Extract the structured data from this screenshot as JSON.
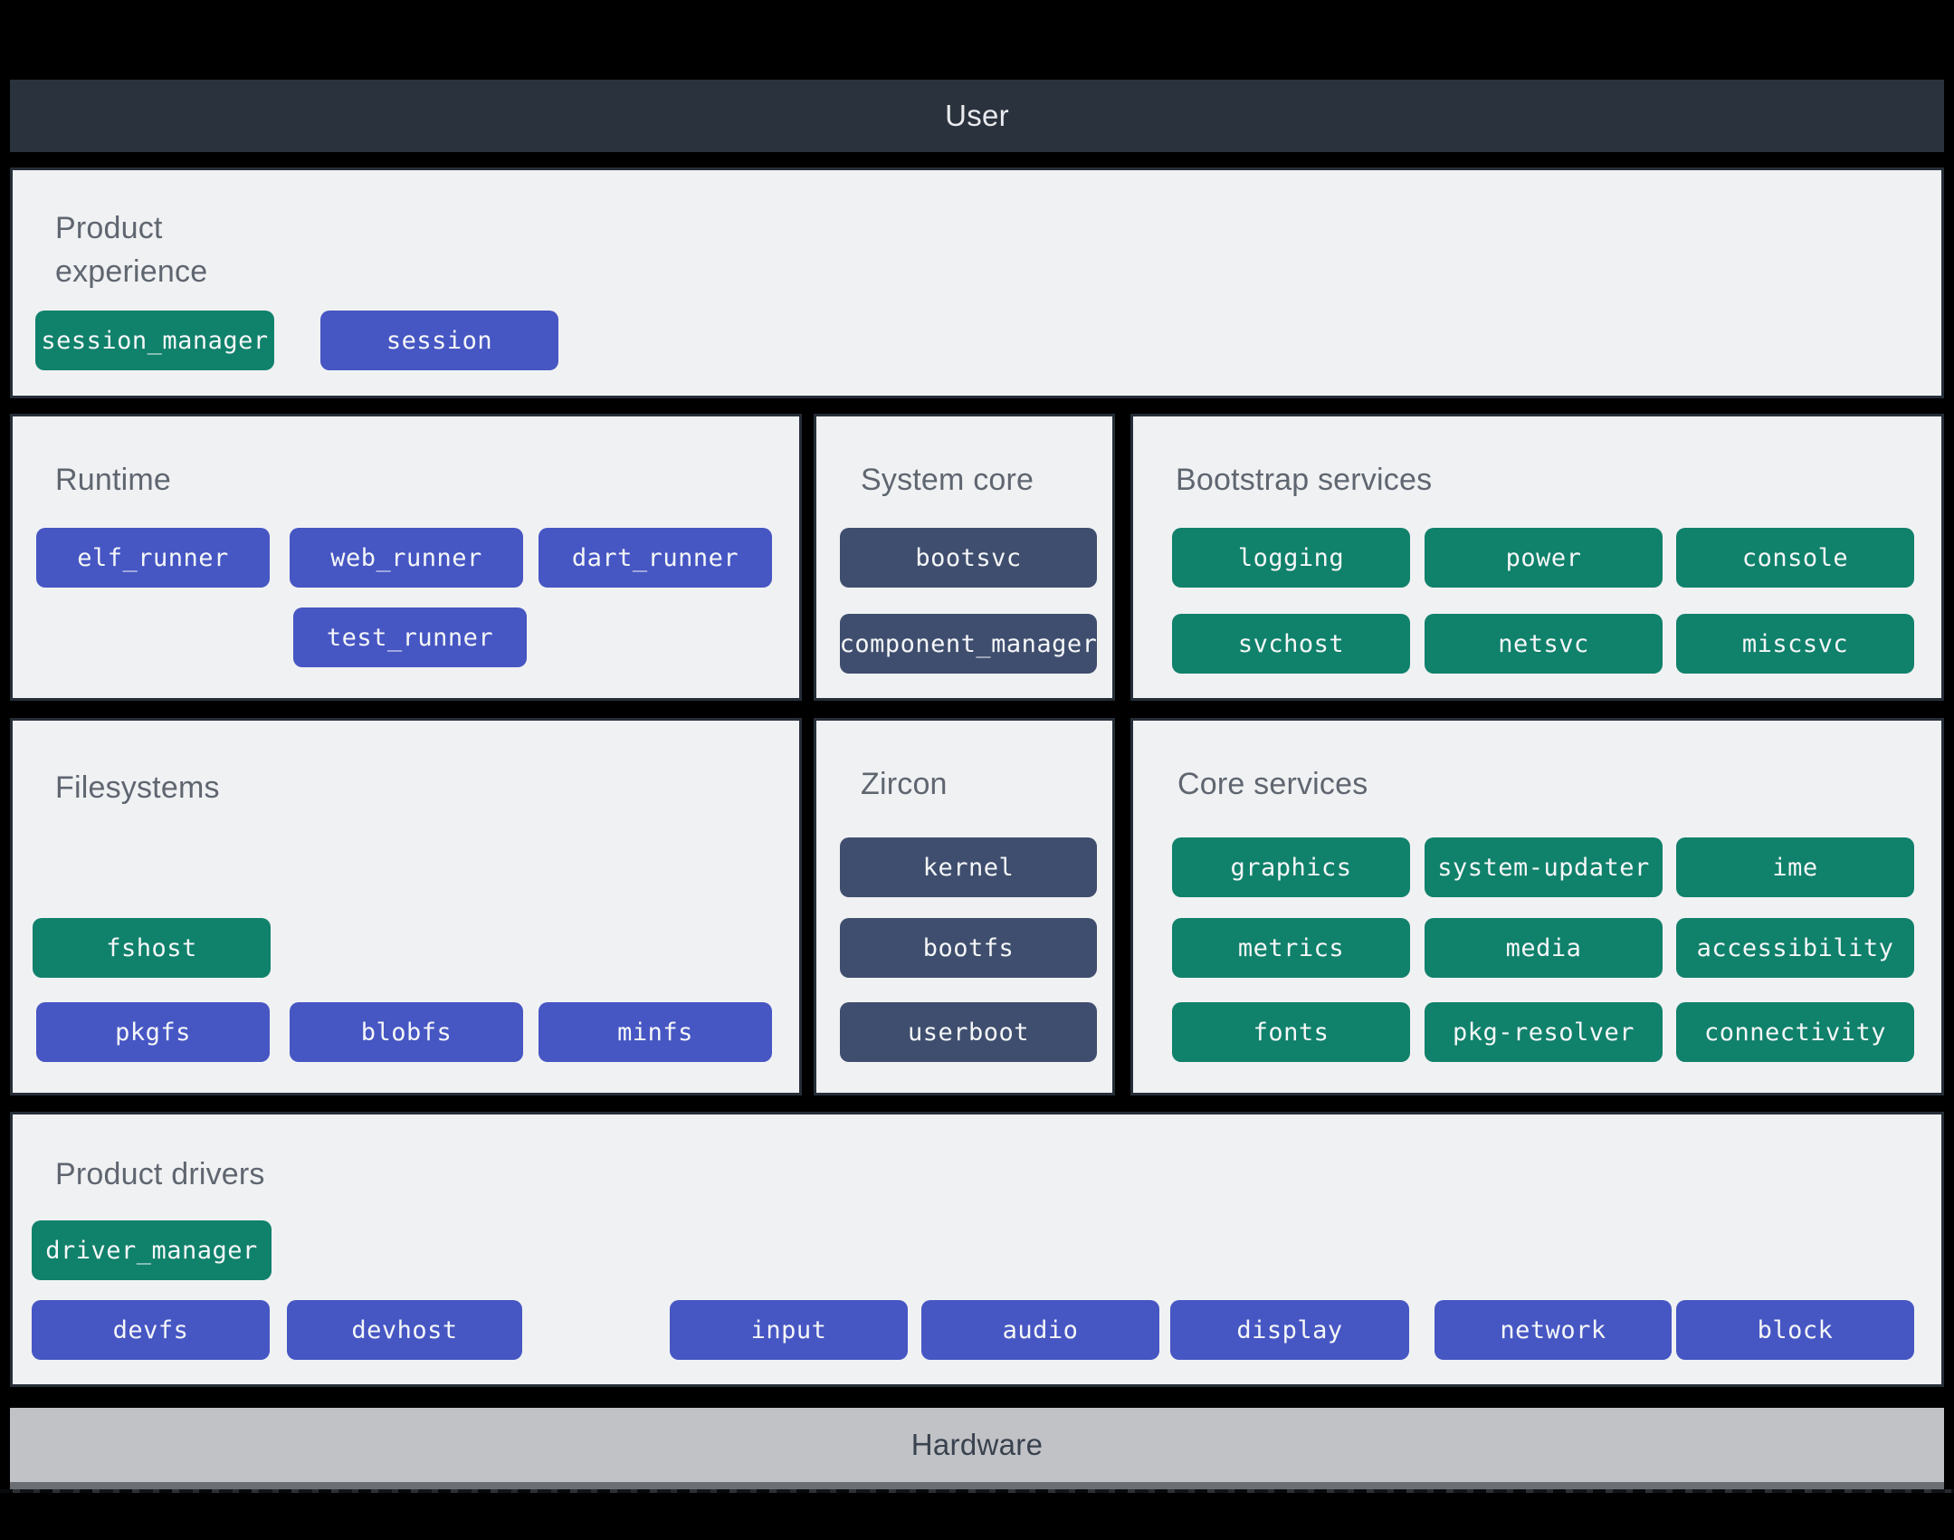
{
  "colors": {
    "canvas": "#000000",
    "bar-dark": "#2A323E",
    "section-bg": "#F0F1F3",
    "section-border": "#262E38",
    "chip-green": "#10816B",
    "chip-blue": "#4656C3",
    "chip-slate": "#3F4E6E",
    "title-gray": "#5F6670",
    "chip-text": "#F5F7F8",
    "hardware-bg": "#C0C2C6",
    "hardware-text": "#39424E",
    "hardware-edge": "#6B6E73"
  },
  "user_bar": {
    "label": "User"
  },
  "hardware_bar": {
    "label": "Hardware"
  },
  "sections": {
    "product_experience": {
      "title": "Product experience",
      "chips": {
        "session_manager": "session_manager",
        "session": "session"
      }
    },
    "runtime": {
      "title": "Runtime",
      "chips": {
        "elf_runner": "elf_runner",
        "web_runner": "web_runner",
        "dart_runner": "dart_runner",
        "test_runner": "test_runner"
      }
    },
    "system_core": {
      "title": "System core",
      "chips": {
        "bootsvc": "bootsvc",
        "component_manager": "component_manager"
      }
    },
    "bootstrap_services": {
      "title": "Bootstrap services",
      "chips": {
        "logging": "logging",
        "power": "power",
        "console": "console",
        "svchost": "svchost",
        "netsvc": "netsvc",
        "miscsvc": "miscsvc"
      }
    },
    "filesystems": {
      "title": "Filesystems",
      "chips": {
        "fshost": "fshost",
        "pkgfs": "pkgfs",
        "blobfs": "blobfs",
        "minfs": "minfs"
      }
    },
    "zircon": {
      "title": "Zircon",
      "chips": {
        "kernel": "kernel",
        "bootfs": "bootfs",
        "userboot": "userboot"
      }
    },
    "core_services": {
      "title": "Core services",
      "chips": {
        "graphics": "graphics",
        "system_updater": "system-updater",
        "ime": "ime",
        "metrics": "metrics",
        "media": "media",
        "accessibility": "accessibility",
        "fonts": "fonts",
        "pkg_resolver": "pkg-resolver",
        "connectivity": "connectivity"
      }
    },
    "product_drivers": {
      "title": "Product drivers",
      "chips": {
        "driver_manager": "driver_manager",
        "devfs": "devfs",
        "devhost": "devhost",
        "input": "input",
        "audio": "audio",
        "display": "display",
        "network": "network",
        "block": "block"
      }
    }
  }
}
